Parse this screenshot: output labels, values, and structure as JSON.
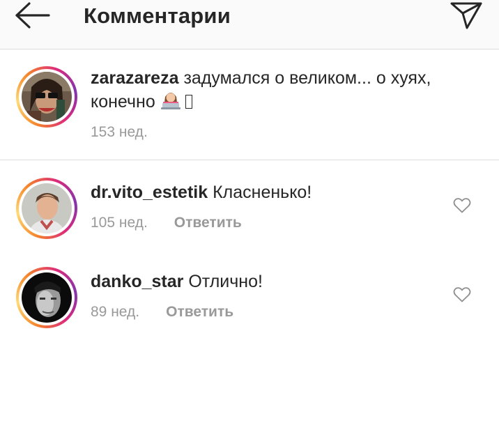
{
  "header": {
    "title": "Комментарии",
    "back_icon": "arrow-left-icon",
    "send_icon": "paper-plane-icon"
  },
  "caption": {
    "username": "zarazareza",
    "text": "задумался о великом... о хуях, конечно",
    "emoji_icon": "woman-at-laptop-emoji",
    "time": "153 нед."
  },
  "comments": [
    {
      "username": "dr.vito_estetik",
      "text": "Класненько!",
      "time": "105 нед.",
      "reply_label": "Ответить",
      "like_icon": "heart-outline-icon"
    },
    {
      "username": "danko_star",
      "text": "Отлично!",
      "time": "89 нед.",
      "reply_label": "Ответить",
      "like_icon": "heart-outline-icon"
    }
  ],
  "colors": {
    "text": "#262626",
    "muted": "#999999",
    "divider": "#dbdbdb",
    "header_bg": "#fafafa",
    "story_ring": [
      "#f58529",
      "#dd2a7b",
      "#8134af"
    ]
  }
}
